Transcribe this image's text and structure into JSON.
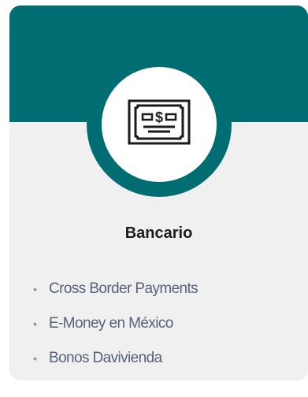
{
  "card": {
    "title": "Bancario",
    "icon": "banknote-icon",
    "colors": {
      "header": "#006d73",
      "background": "#f0f0f0",
      "title": "#1c1c1c",
      "link": "#56617a"
    },
    "items": [
      {
        "label": "Cross Border Payments"
      },
      {
        "label": "E-Money en México"
      },
      {
        "label": "Bonos Davivienda"
      }
    ]
  }
}
